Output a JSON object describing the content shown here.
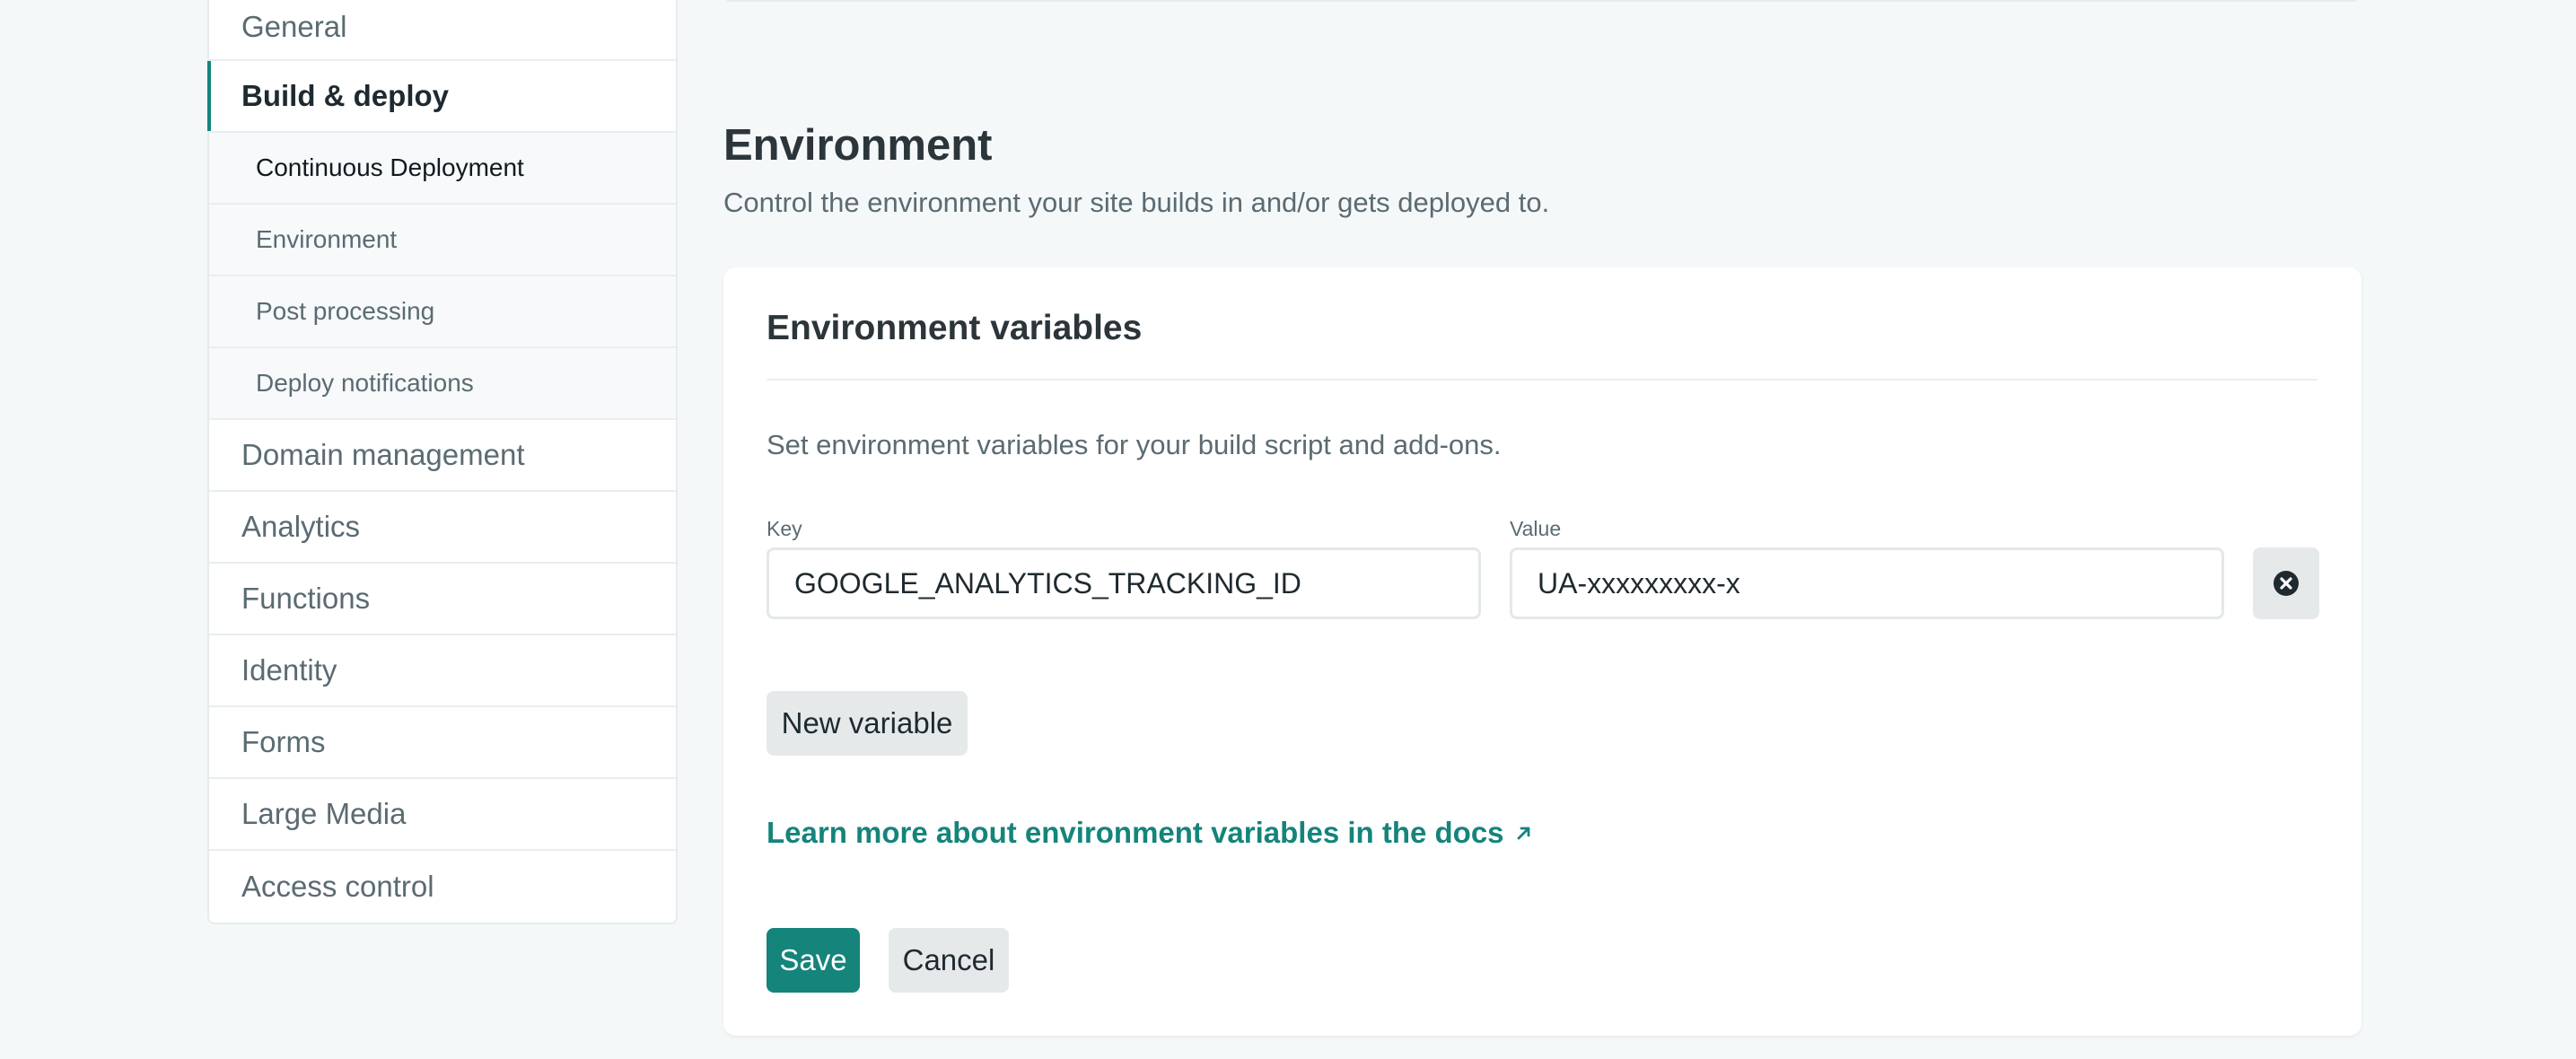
{
  "sidebar": {
    "items": [
      {
        "label": "General"
      },
      {
        "label": "Build & deploy"
      },
      {
        "label": "Domain management"
      },
      {
        "label": "Analytics"
      },
      {
        "label": "Functions"
      },
      {
        "label": "Identity"
      },
      {
        "label": "Forms"
      },
      {
        "label": "Large Media"
      },
      {
        "label": "Access control"
      }
    ],
    "sub_items": [
      {
        "label": "Continuous Deployment"
      },
      {
        "label": "Environment"
      },
      {
        "label": "Post processing"
      },
      {
        "label": "Deploy notifications"
      }
    ]
  },
  "section": {
    "title": "Environment",
    "description": "Control the environment your site builds in and/or gets deployed to."
  },
  "card": {
    "title": "Environment variables",
    "description": "Set environment variables for your build script and add-ons.",
    "key_label": "Key",
    "value_label": "Value",
    "key_value": "GOOGLE_ANALYTICS_TRACKING_ID",
    "value_value": "UA-xxxxxxxxx-x",
    "new_variable_label": "New variable",
    "docs_link_label": "Learn more about environment variables in the docs",
    "save_label": "Save",
    "cancel_label": "Cancel"
  },
  "colors": {
    "accent": "#15847b",
    "background": "#f5f8f9"
  }
}
